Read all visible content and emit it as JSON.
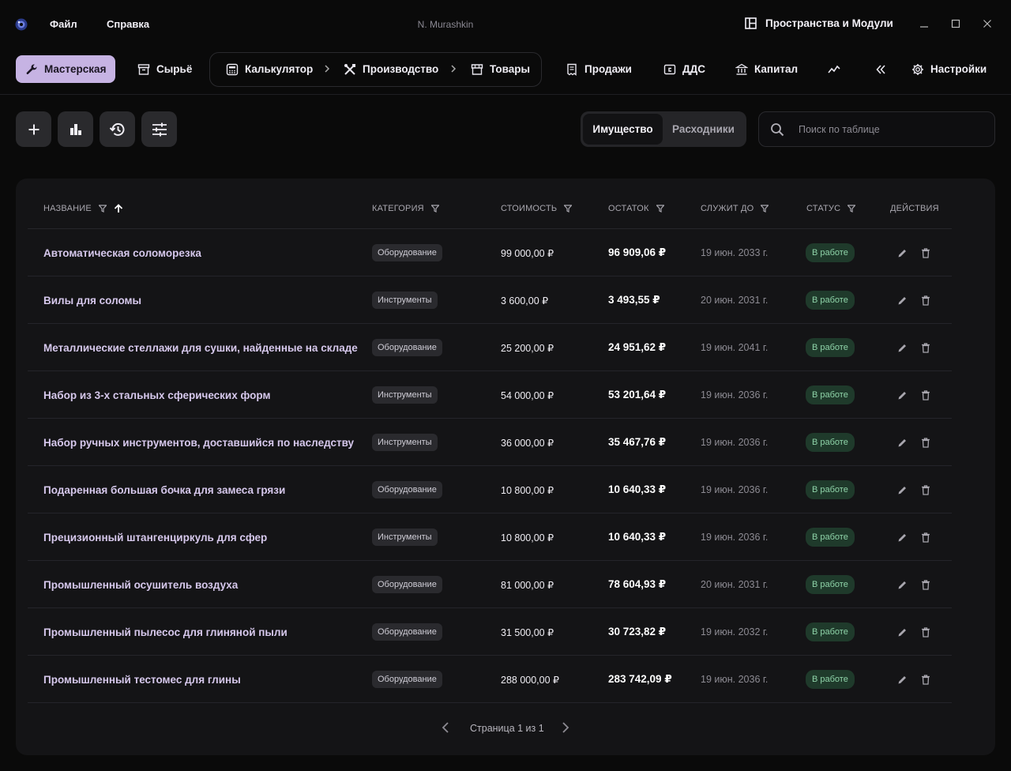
{
  "titlebar": {
    "menu": [
      "Файл",
      "Справка"
    ],
    "user": "N. Murashkin",
    "spaces_label": "Пространства и Модули"
  },
  "nav": {
    "workshop": "Мастерская",
    "raw": "Сырьё",
    "calculator": "Калькулятор",
    "production": "Производство",
    "goods": "Товары",
    "sales": "Продажи",
    "dds": "ДДС",
    "capital": "Капитал",
    "settings": "Настройки"
  },
  "tabs": {
    "property": "Имущество",
    "consumables": "Расходники"
  },
  "search": {
    "placeholder": "Поиск по таблице"
  },
  "table": {
    "headers": {
      "name": "Название",
      "category": "Категория",
      "cost": "Стоимость",
      "remainder": "Остаток",
      "serves_until": "Служит до",
      "status": "Статус",
      "actions": "Действия"
    },
    "rows": [
      {
        "name": "Автоматическая соломорезка",
        "category": "Оборудование",
        "cost": "99 000,00 ₽",
        "remainder": "96 909,06 ₽",
        "date": "19 июн. 2033 г.",
        "status": "В работе"
      },
      {
        "name": "Вилы для соломы",
        "category": "Инструменты",
        "cost": "3 600,00 ₽",
        "remainder": "3 493,55 ₽",
        "date": "20 июн. 2031 г.",
        "status": "В работе"
      },
      {
        "name": "Металлические стеллажи для сушки, найденные на складе",
        "category": "Оборудование",
        "cost": "25 200,00 ₽",
        "remainder": "24 951,62 ₽",
        "date": "19 июн. 2041 г.",
        "status": "В работе"
      },
      {
        "name": "Набор из 3-х стальных сферических форм",
        "category": "Инструменты",
        "cost": "54 000,00 ₽",
        "remainder": "53 201,64 ₽",
        "date": "19 июн. 2036 г.",
        "status": "В работе"
      },
      {
        "name": "Набор ручных инструментов, доставшийся по наследству",
        "category": "Инструменты",
        "cost": "36 000,00 ₽",
        "remainder": "35 467,76 ₽",
        "date": "19 июн. 2036 г.",
        "status": "В работе"
      },
      {
        "name": "Подаренная большая бочка для замеса грязи",
        "category": "Оборудование",
        "cost": "10 800,00 ₽",
        "remainder": "10 640,33 ₽",
        "date": "19 июн. 2036 г.",
        "status": "В работе"
      },
      {
        "name": "Прецизионный штангенциркуль для сфер",
        "category": "Инструменты",
        "cost": "10 800,00 ₽",
        "remainder": "10 640,33 ₽",
        "date": "19 июн. 2036 г.",
        "status": "В работе"
      },
      {
        "name": "Промышленный осушитель воздуха",
        "category": "Оборудование",
        "cost": "81 000,00 ₽",
        "remainder": "78 604,93 ₽",
        "date": "20 июн. 2031 г.",
        "status": "В работе"
      },
      {
        "name": "Промышленный пылесос для глиняной пыли",
        "category": "Оборудование",
        "cost": "31 500,00 ₽",
        "remainder": "30 723,82 ₽",
        "date": "19 июн. 2032 г.",
        "status": "В работе"
      },
      {
        "name": "Промышленный тестомес для глины",
        "category": "Оборудование",
        "cost": "288 000,00 ₽",
        "remainder": "283 742,09 ₽",
        "date": "19 июн. 2036 г.",
        "status": "В работе"
      }
    ]
  },
  "pagination": {
    "text": "Страница 1 из 1"
  },
  "icons": {
    "row_actions": [
      "pencil-icon",
      "trash-icon"
    ],
    "toolbar": [
      "plus-icon",
      "bar-chart-icon",
      "history-icon",
      "sliders-icon"
    ]
  },
  "colors": {
    "accent": "#c6b3e3",
    "name_text": "#d6c8ec",
    "status_bg": "#1f3a2b",
    "status_text": "#8fd4a9",
    "background": "#0a0a0a",
    "card": "#141416"
  }
}
